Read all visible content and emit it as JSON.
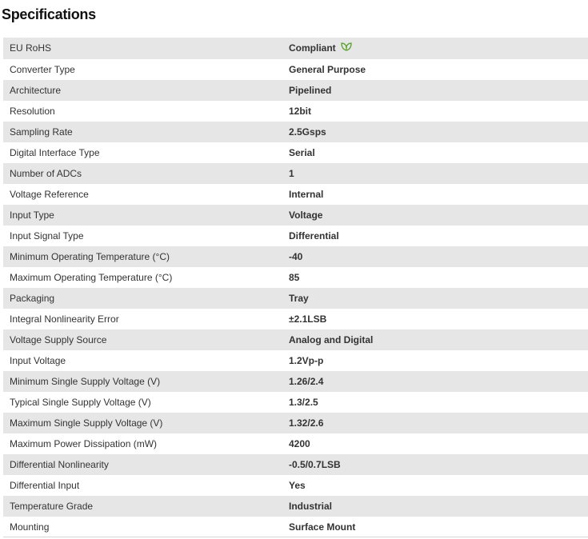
{
  "title": "Specifications",
  "rohs_icon": "leaf-icon",
  "colors": {
    "row_stripe": "#e6e6e6",
    "leaf": "#5aa02c"
  },
  "specs": [
    {
      "name": "EU RoHS",
      "value": "Compliant"
    },
    {
      "name": "Converter Type",
      "value": "General Purpose"
    },
    {
      "name": "Architecture",
      "value": "Pipelined"
    },
    {
      "name": "Resolution",
      "value": "12bit"
    },
    {
      "name": "Sampling Rate",
      "value": "2.5Gsps"
    },
    {
      "name": "Digital Interface Type",
      "value": "Serial"
    },
    {
      "name": "Number of ADCs",
      "value": "1"
    },
    {
      "name": "Voltage Reference",
      "value": "Internal"
    },
    {
      "name": "Input Type",
      "value": "Voltage"
    },
    {
      "name": "Input Signal Type",
      "value": "Differential"
    },
    {
      "name": "Minimum Operating Temperature (°C)",
      "value": "-40"
    },
    {
      "name": "Maximum Operating Temperature (°C)",
      "value": "85"
    },
    {
      "name": "Packaging",
      "value": "Tray"
    },
    {
      "name": "Integral Nonlinearity Error",
      "value": "±2.1LSB"
    },
    {
      "name": "Voltage Supply Source",
      "value": "Analog and Digital"
    },
    {
      "name": "Input Voltage",
      "value": "1.2Vp-p"
    },
    {
      "name": "Minimum Single Supply Voltage (V)",
      "value": "1.26/2.4"
    },
    {
      "name": "Typical Single Supply Voltage (V)",
      "value": "1.3/2.5"
    },
    {
      "name": "Maximum Single Supply Voltage (V)",
      "value": "1.32/2.6"
    },
    {
      "name": "Maximum Power Dissipation (mW)",
      "value": "4200"
    },
    {
      "name": "Differential Nonlinearity",
      "value": "-0.5/0.7LSB"
    },
    {
      "name": "Differential Input",
      "value": "Yes"
    },
    {
      "name": "Temperature Grade",
      "value": "Industrial"
    },
    {
      "name": "Mounting",
      "value": "Surface Mount"
    }
  ]
}
